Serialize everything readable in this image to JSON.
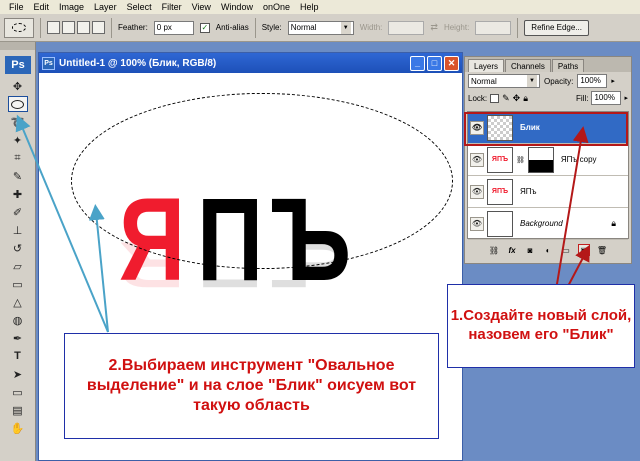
{
  "menu": [
    "File",
    "Edit",
    "Image",
    "Layer",
    "Select",
    "Filter",
    "View",
    "Window",
    "onOne",
    "Help"
  ],
  "options": {
    "feather_label": "Feather:",
    "feather_value": "0 px",
    "antialias_label": "Anti-alias",
    "style_label": "Style:",
    "style_value": "Normal",
    "width_label": "Width:",
    "height_label": "Height:",
    "refine_label": "Refine Edge..."
  },
  "tools": {
    "ps_logo": "Ps"
  },
  "document": {
    "title": "Untitled-1 @ 100% (Блик, RGB/8)",
    "letters": [
      {
        "char": "Я",
        "color": "#f01c2e"
      },
      {
        "char": "П",
        "color": "#000000"
      },
      {
        "char": "Ъ",
        "color": "#000000"
      }
    ]
  },
  "layers_panel": {
    "tabs": [
      "Layers",
      "Channels",
      "Paths"
    ],
    "blend_mode": "Normal",
    "opacity_label": "Opacity:",
    "opacity_value": "100%",
    "lock_label": "Lock:",
    "fill_label": "Fill:",
    "fill_value": "100%",
    "thumb_text": "ЯПЪ",
    "layers": [
      {
        "name": "Блик",
        "selected": true
      },
      {
        "name": "ЯПъ copy",
        "selected": false
      },
      {
        "name": "ЯПъ",
        "selected": false
      },
      {
        "name": "Background",
        "selected": false
      }
    ],
    "footer_icons": [
      "link-icon",
      "fx-icon",
      "mask-icon",
      "adjustment-icon",
      "group-icon",
      "new-layer-icon",
      "trash-icon"
    ]
  },
  "annotations": {
    "note1": "1.Создайте новый слой, назовем его \"Блик\"",
    "note2": "2.Выбираем инструмент \"Овальное выделение\" и на слое \"Блик\" оисуем вот такую область",
    "text_color": "#d01010",
    "arrow_color_red": "#b41818",
    "arrow_color_blue": "#4aa3c8"
  }
}
